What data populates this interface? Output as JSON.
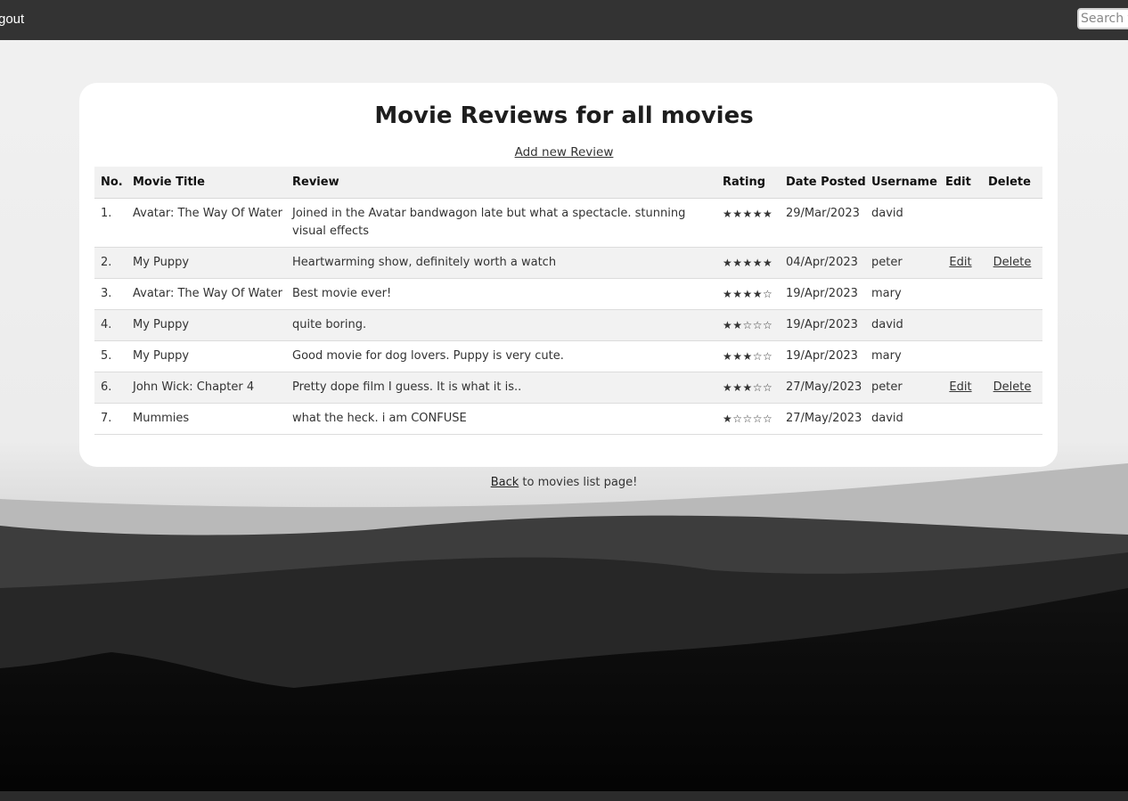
{
  "topbar": {
    "logout_label": "gout",
    "search_placeholder": "Search f"
  },
  "page": {
    "title": "Movie Reviews for all movies",
    "add_review_label": "Add new Review",
    "back_link_label": "Back",
    "back_text": " to movies list page!"
  },
  "table": {
    "headers": [
      "No.",
      "Movie Title",
      "Review",
      "Rating",
      "Date Posted",
      "Username",
      "Edit",
      "Delete"
    ],
    "rows": [
      {
        "no": "1.",
        "title": "Avatar: The Way Of Water",
        "review": "Joined in the Avatar bandwagon late but what a spectacle. stunning visual effects",
        "rating": 5,
        "rating_stars": "★★★★★",
        "date": "29/Mar/2023",
        "username": "david",
        "edit": "",
        "delete": ""
      },
      {
        "no": "2.",
        "title": "My Puppy",
        "review": "Heartwarming show, definitely worth a watch",
        "rating": 5,
        "rating_stars": "★★★★★",
        "date": "04/Apr/2023",
        "username": "peter",
        "edit": "Edit",
        "delete": "Delete"
      },
      {
        "no": "3.",
        "title": "Avatar: The Way Of Water",
        "review": "Best movie ever!",
        "rating": 4,
        "rating_stars": "★★★★☆",
        "date": "19/Apr/2023",
        "username": "mary",
        "edit": "",
        "delete": ""
      },
      {
        "no": "4.",
        "title": "My Puppy",
        "review": "quite boring.",
        "rating": 2,
        "rating_stars": "★★☆☆☆",
        "date": "19/Apr/2023",
        "username": "david",
        "edit": "",
        "delete": ""
      },
      {
        "no": "5.",
        "title": "My Puppy",
        "review": "Good movie for dog lovers. Puppy is very cute.",
        "rating": 3,
        "rating_stars": "★★★☆☆",
        "date": "19/Apr/2023",
        "username": "mary",
        "edit": "",
        "delete": ""
      },
      {
        "no": "6.",
        "title": "John Wick: Chapter 4",
        "review": "Pretty dope film I guess. It is what it is..",
        "rating": 3,
        "rating_stars": "★★★☆☆",
        "date": "27/May/2023",
        "username": "peter",
        "edit": "Edit",
        "delete": "Delete"
      },
      {
        "no": "7.",
        "title": "Mummies",
        "review": "what the heck. i am CONFUSE",
        "rating": 1,
        "rating_stars": "★☆☆☆☆",
        "date": "27/May/2023",
        "username": "david",
        "edit": "",
        "delete": ""
      }
    ]
  },
  "colors": {
    "topbar": "#333333",
    "page_background": "#efefef",
    "card": "#ffffff",
    "stripe": "#f2f2f2"
  }
}
